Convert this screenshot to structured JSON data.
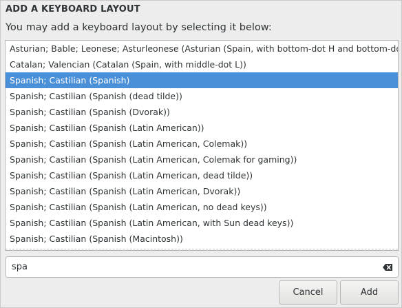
{
  "dialog": {
    "title": "ADD A KEYBOARD LAYOUT",
    "subtitle": "You may add a keyboard layout by selecting it below:"
  },
  "layouts": {
    "selected_index": 2,
    "items": [
      {
        "label": "Asturian; Bable; Leonese; Asturleonese (Asturian (Spain, with bottom-dot H and bottom-dot L))"
      },
      {
        "label": "Catalan; Valencian (Catalan (Spain, with middle-dot L))"
      },
      {
        "label": "Spanish; Castilian (Spanish)"
      },
      {
        "label": "Spanish; Castilian (Spanish (dead tilde))"
      },
      {
        "label": "Spanish; Castilian (Spanish (Dvorak))"
      },
      {
        "label": "Spanish; Castilian (Spanish (Latin American))"
      },
      {
        "label": "Spanish; Castilian (Spanish (Latin American, Colemak))"
      },
      {
        "label": "Spanish; Castilian (Spanish (Latin American, Colemak for gaming))"
      },
      {
        "label": "Spanish; Castilian (Spanish (Latin American, dead tilde))"
      },
      {
        "label": "Spanish; Castilian (Spanish (Latin American, Dvorak))"
      },
      {
        "label": "Spanish; Castilian (Spanish (Latin American, no dead keys))"
      },
      {
        "label": "Spanish; Castilian (Spanish (Latin American, with Sun dead keys))"
      },
      {
        "label": "Spanish; Castilian (Spanish (Macintosh))"
      }
    ]
  },
  "search": {
    "value": "spa",
    "clear_icon": "edit-clear-icon"
  },
  "buttons": {
    "cancel_label": "Cancel",
    "add_label": "Add"
  },
  "colors": {
    "selection": "#4a90d9",
    "selection_text": "#ffffff",
    "background": "#ededed"
  }
}
